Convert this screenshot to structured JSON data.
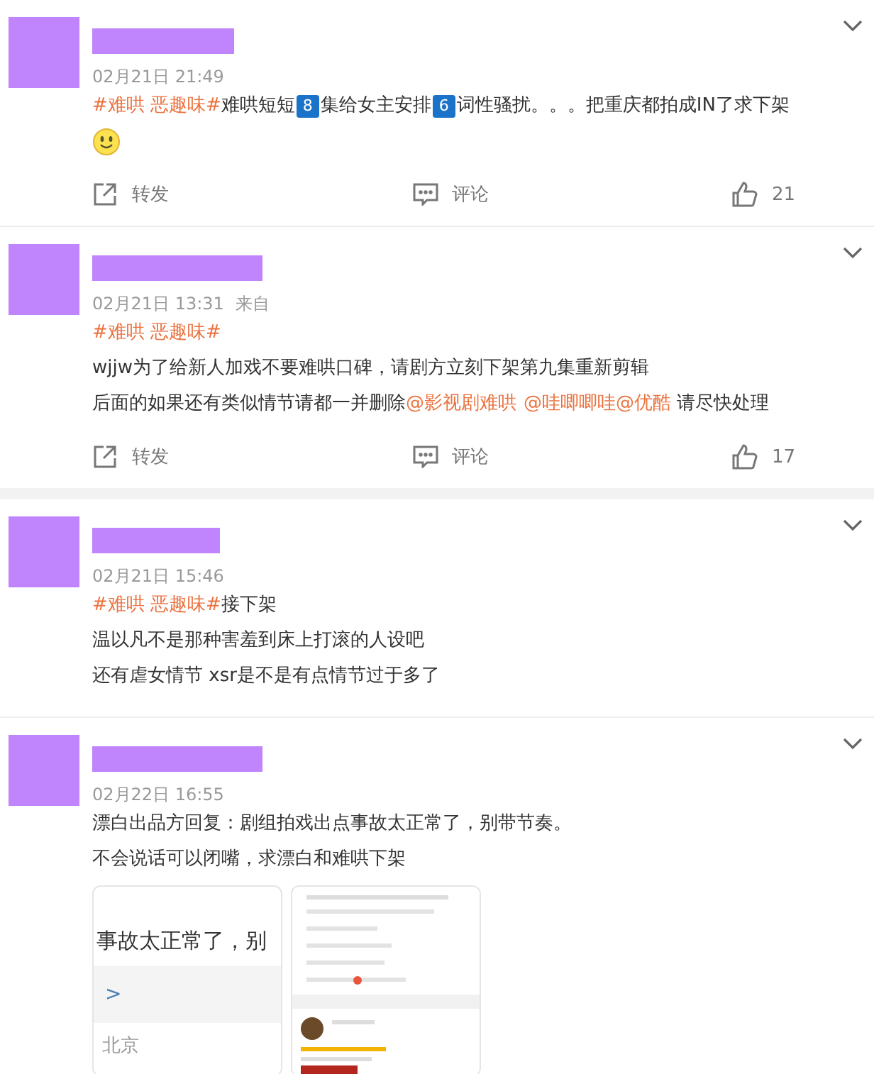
{
  "posts": [
    {
      "time": "02月21日 21:49",
      "lines": [
        [
          {
            "kind": "tag",
            "text": "#难哄 恶趣味#"
          },
          {
            "kind": "text",
            "text": "难哄短短"
          },
          {
            "kind": "keycap",
            "text": "8"
          },
          {
            "kind": "text",
            "text": "集给女主安排"
          },
          {
            "kind": "keycap",
            "text": "6"
          },
          {
            "kind": "text",
            "text": "词性骚扰。。。把重庆都拍成IN了求下架"
          }
        ],
        [
          {
            "kind": "emoji"
          }
        ]
      ],
      "actions": {
        "repost": "转发",
        "comment": "评论",
        "likes": "21"
      }
    },
    {
      "time": "02月21日 13:31",
      "source": "来自",
      "lines": [
        [
          {
            "kind": "tag",
            "text": "#难哄 恶趣味#"
          }
        ],
        [
          {
            "kind": "text",
            "text": "wjjw为了给新人加戏不要难哄口碑，请剧方立刻下架第九集重新剪辑"
          }
        ],
        [
          {
            "kind": "text",
            "text": "后面的如果还有类似情节请都一并删除"
          },
          {
            "kind": "mention",
            "text": "@影视剧难哄",
            "gap_after": true
          },
          {
            "kind": "mention",
            "text": "@哇唧唧哇"
          },
          {
            "kind": "mention",
            "text": "@优酷"
          },
          {
            "kind": "text",
            "text": " 请尽快处理"
          }
        ]
      ],
      "actions": {
        "repost": "转发",
        "comment": "评论",
        "likes": "17"
      }
    },
    {
      "time": "02月21日 15:46",
      "lines": [
        [
          {
            "kind": "tag",
            "text": "#难哄 恶趣味#"
          },
          {
            "kind": "text",
            "text": "接下架"
          }
        ],
        [
          {
            "kind": "text",
            "text": "温以凡不是那种害羞到床上打滚的人设吧"
          }
        ],
        [
          {
            "kind": "text",
            "text": "还有虐女情节 xsr是不是有点情节过于多了"
          }
        ]
      ]
    },
    {
      "time": "02月22日 16:55",
      "lines": [
        [
          {
            "kind": "text",
            "text": "漂白出品方回复：剧组拍戏出点事故太正常了，别带节奏。"
          }
        ],
        [
          {
            "kind": "text",
            "text": "不会说话可以闭嘴，求漂白和难哄下架"
          }
        ]
      ],
      "images": [
        {
          "kind": "text-shot",
          "text": "事故太正常了，别",
          "link": ">",
          "place": "北京"
        },
        {
          "kind": "picture"
        }
      ]
    }
  ]
}
